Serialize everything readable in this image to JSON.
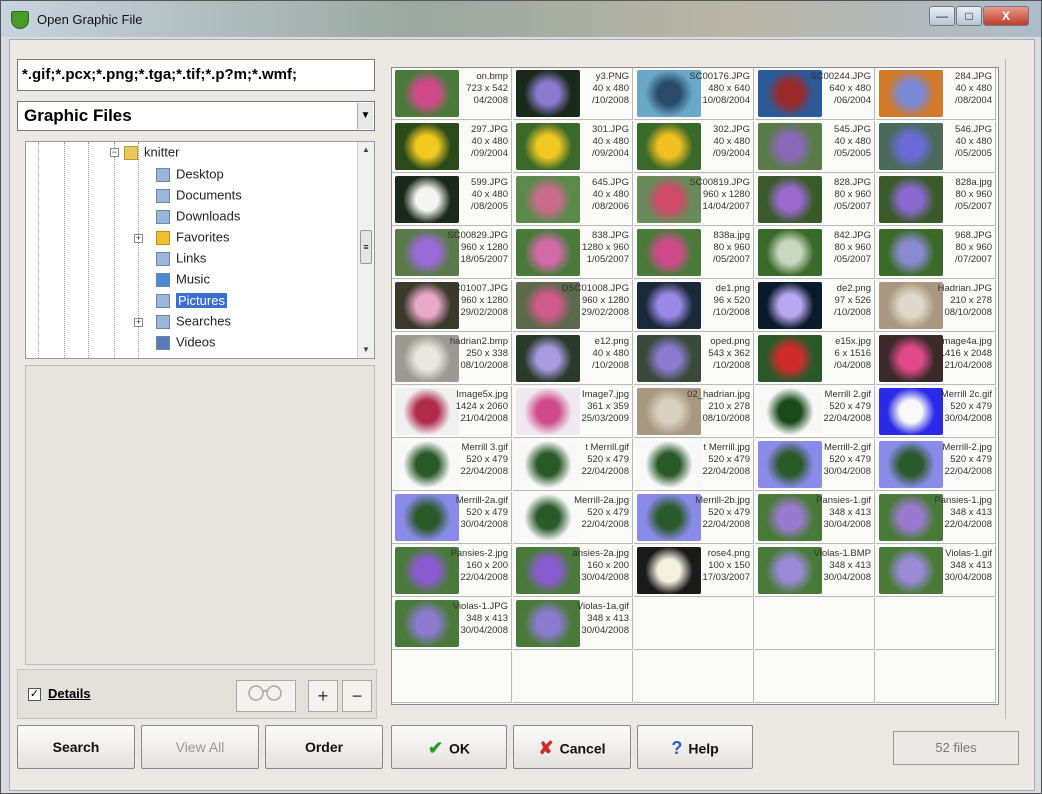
{
  "window": {
    "title": "Open Graphic File",
    "minimize": "—",
    "maximize": "□",
    "close": "X"
  },
  "file_mask": "*.gif;*.pcx;*.png;*.tga;*.tif;*.p?m;*.wmf;",
  "file_type": {
    "value": "Graphic Files"
  },
  "tree": {
    "items": [
      "knitter",
      "Desktop",
      "Documents",
      "Downloads",
      "Favorites",
      "Links",
      "Music",
      "Pictures",
      "Searches",
      "Videos"
    ],
    "selected": "Pictures"
  },
  "details": {
    "label": "Details",
    "checked": "✓"
  },
  "zoom": {
    "in": "+",
    "out": "−"
  },
  "thumbnails": [
    [
      "on.bmp",
      "723 x 542",
      "04/2008"
    ],
    [
      "y3.PNG",
      "40 x 480",
      "/10/2008"
    ],
    [
      "SC00176.JPG",
      "480 x 640",
      "10/08/2004"
    ],
    [
      "SC00244.JPG",
      "640 x 480",
      "/06/2004"
    ],
    [
      "284.JPG",
      "40 x 480",
      "/08/2004"
    ],
    [
      "297.JPG",
      "40 x 480",
      "/09/2004"
    ],
    [
      "301.JPG",
      "40 x 480",
      "/09/2004"
    ],
    [
      "302.JPG",
      "40 x 480",
      "/09/2004"
    ],
    [
      "545.JPG",
      "40 x 480",
      "/05/2005"
    ],
    [
      "546.JPG",
      "40 x 480",
      "/05/2005"
    ],
    [
      "599.JPG",
      "40 x 480",
      "/08/2005"
    ],
    [
      "645.JPG",
      "40 x 480",
      "/08/2006"
    ],
    [
      "SC00819.JPG",
      "960 x 1280",
      "14/04/2007"
    ],
    [
      "828.JPG",
      "80 x 960",
      "/05/2007"
    ],
    [
      "828a.jpg",
      "80 x 960",
      "/05/2007"
    ],
    [
      "SC00829.JPG",
      "960 x 1280",
      "18/05/2007"
    ],
    [
      "838.JPG",
      "1280 x 960",
      "1/05/2007"
    ],
    [
      "838a.jpg",
      "80 x 960",
      "/05/2007"
    ],
    [
      "842.JPG",
      "80 x 960",
      "/05/2007"
    ],
    [
      "968.JPG",
      "80 x 960",
      "/07/2007"
    ],
    [
      "SC01007.JPG",
      "960 x 1280",
      "29/02/2008"
    ],
    [
      "DSC01008.JPG",
      "960 x 1280",
      "29/02/2008"
    ],
    [
      "de1.png",
      "96 x 520",
      "/10/2008"
    ],
    [
      "de2.png",
      "97 x 526",
      "/10/2008"
    ],
    [
      "Hadrian.JPG",
      "210 x 278",
      "08/10/2008"
    ],
    [
      "hadrian2.bmp",
      "250 x 338",
      "08/10/2008"
    ],
    [
      "e12.png",
      "40 x 480",
      "/10/2008"
    ],
    [
      "oped.png",
      "543 x 362",
      "/10/2008"
    ],
    [
      "e15x.jpg",
      "6 x 1516",
      "/04/2008"
    ],
    [
      "Image4a.jpg",
      "1416 x 2048",
      "21/04/2008"
    ],
    [
      "Image5x.jpg",
      "1424 x 2060",
      "21/04/2008"
    ],
    [
      "Image7.jpg",
      "361 x 359",
      "25/03/2009"
    ],
    [
      "02_hadrian.jpg",
      "210 x 278",
      "08/10/2008"
    ],
    [
      "Merrill 2.gif",
      "520 x 479",
      "22/04/2008"
    ],
    [
      "Merrill 2c.gif",
      "520 x 479",
      "30/04/2008"
    ],
    [
      "Merrill 3.gif",
      "520 x 479",
      "22/04/2008"
    ],
    [
      "t Merrill.gif",
      "520 x 479",
      "22/04/2008"
    ],
    [
      "t Merrill.jpg",
      "520 x 479",
      "22/04/2008"
    ],
    [
      "Merrill-2.gif",
      "520 x 479",
      "30/04/2008"
    ],
    [
      "Merrill-2.jpg",
      "520 x 479",
      "22/04/2008"
    ],
    [
      "Merrill-2a.gif",
      "520 x 479",
      "30/04/2008"
    ],
    [
      "Merrill-2a.jpg",
      "520 x 479",
      "22/04/2008"
    ],
    [
      "Merrill-2b.jpg",
      "520 x 479",
      "22/04/2008"
    ],
    [
      "Pansies-1.gif",
      "348 x 413",
      "30/04/2008"
    ],
    [
      "Pansies-1.jpg",
      "348 x 413",
      "22/04/2008"
    ],
    [
      "Pansies-2.jpg",
      "160 x 200",
      "22/04/2008"
    ],
    [
      "ansies-2a.jpg",
      "160 x 200",
      "30/04/2008"
    ],
    [
      "rose4.png",
      "100 x 150",
      "17/03/2007"
    ],
    [
      "Violas-1.BMP",
      "348 x 413",
      "30/04/2008"
    ],
    [
      "Violas-1.gif",
      "348 x 413",
      "30/04/2008"
    ],
    [
      "Violas-1.JPG",
      "348 x 413",
      "30/04/2008"
    ],
    [
      "Violas-1a.gif",
      "348 x 413",
      "30/04/2008"
    ]
  ],
  "thumb_colors": [
    [
      "#4a7a3a",
      "#d04a8a"
    ],
    [
      "#1a2a1a",
      "#8a7ad0"
    ],
    [
      "#6aa8c8",
      "#2a4a6a"
    ],
    [
      "#2a5a9a",
      "#9a2a2a"
    ],
    [
      "#d07a2a",
      "#7a8ad8"
    ],
    [
      "#2a4a1a",
      "#f0c820"
    ],
    [
      "#3a6a2a",
      "#f0c820"
    ],
    [
      "#3a6a2a",
      "#f0c020"
    ],
    [
      "#5a7a4a",
      "#8a6ab8"
    ],
    [
      "#4a6a5a",
      "#6a6ad8"
    ],
    [
      "#1a2a1a",
      "#f4f4f0"
    ],
    [
      "#5a8a4a",
      "#c86a8a"
    ],
    [
      "#6a8a5a",
      "#d04a6a"
    ],
    [
      "#3a5a2a",
      "#9a6ad0"
    ],
    [
      "#3a5a2a",
      "#8a6ad0"
    ],
    [
      "#5a7a4a",
      "#9a6ad8"
    ],
    [
      "#4a7a3a",
      "#d06aa8"
    ],
    [
      "#4a7a3a",
      "#d04a8a"
    ],
    [
      "#3a6a2a",
      "#c8d8c0"
    ],
    [
      "#3a6a2a",
      "#8a8ad0"
    ],
    [
      "#3a3a2a",
      "#e8a8c8"
    ],
    [
      "#5a6a4a",
      "#d05a8a"
    ],
    [
      "#1a2a3a",
      "#9a8ae8"
    ],
    [
      "#0a1a2a",
      "#b8a8f0"
    ],
    [
      "#a89880",
      "#e0d8c8"
    ],
    [
      "#9a9a90",
      "#e8e8e0"
    ],
    [
      "#2a3a2a",
      "#a89ae0"
    ],
    [
      "#3a4a3a",
      "#8a7ad0"
    ],
    [
      "#2a5a2a",
      "#d02a2a"
    ],
    [
      "#3a2a2a",
      "#e04a8a"
    ],
    [
      "#f0f0f0",
      "#b02a4a"
    ],
    [
      "#f0e8f0",
      "#d04a8a"
    ],
    [
      "#a89880",
      "#d8d0c0"
    ],
    [
      "#f8f8f8",
      "#1a4a1a"
    ],
    [
      "#2a2ae8",
      "#f8f8f8"
    ],
    [
      "#f8f8f8",
      "#2a5a2a"
    ],
    [
      "#f8f8f8",
      "#2a5a2a"
    ],
    [
      "#f8f8f8",
      "#2a5a2a"
    ],
    [
      "#8a8ae8",
      "#2a5a2a"
    ],
    [
      "#8a8ae8",
      "#2a5a2a"
    ],
    [
      "#8a8ae8",
      "#2a5a2a"
    ],
    [
      "#f8f8f8",
      "#2a5a2a"
    ],
    [
      "#8a8ae8",
      "#2a5a2a"
    ],
    [
      "#4a7a3a",
      "#9a7ad0"
    ],
    [
      "#4a7a3a",
      "#9a7ad0"
    ],
    [
      "#4a7a3a",
      "#8a5ad0"
    ],
    [
      "#4a7a3a",
      "#8a5ad0"
    ],
    [
      "#1a1a1a",
      "#f4f0e0"
    ],
    [
      "#4a7a3a",
      "#9a8ad8"
    ],
    [
      "#4a7a3a",
      "#9a8ad8"
    ],
    [
      "#4a7a3a",
      "#8a7ad0"
    ],
    [
      "#4a7a3a",
      "#8a7ad0"
    ]
  ],
  "buttons": {
    "search": "Search",
    "view_all": "View All",
    "order": "Order",
    "ok": "OK",
    "cancel": "Cancel",
    "help": "Help",
    "ok_icon": "✔",
    "cancel_icon": "✘",
    "help_icon": "?"
  },
  "status": {
    "file_count": "52 files"
  }
}
